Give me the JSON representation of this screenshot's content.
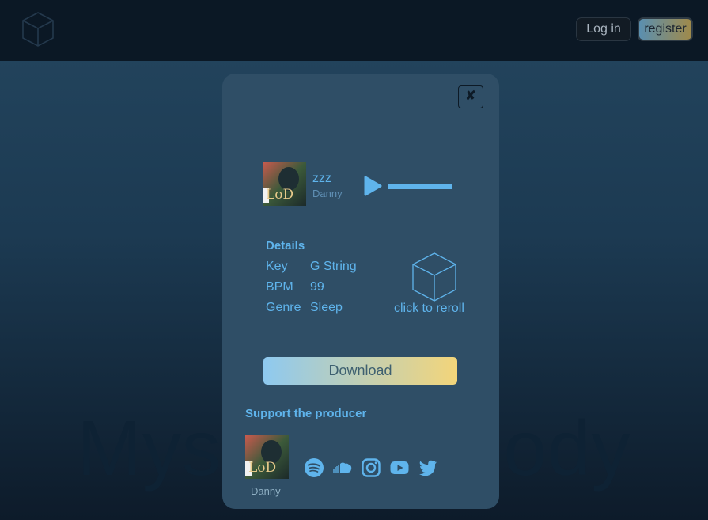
{
  "header": {
    "login_label": "Log in",
    "register_label": "register"
  },
  "background": {
    "title": "Mystery Melody"
  },
  "modal": {
    "close_label": "✘",
    "track": {
      "title": "zzz",
      "artist": "Danny"
    },
    "details": {
      "heading": "Details",
      "rows": [
        {
          "label": "Key",
          "value": "G String"
        },
        {
          "label": "BPM",
          "value": "99"
        },
        {
          "label": "Genre",
          "value": "Sleep"
        }
      ]
    },
    "reroll_label": "click to reroll",
    "download_label": "Download",
    "support": {
      "heading": "Support the producer",
      "producer_name": "Danny",
      "socials": [
        "spotify-icon",
        "soundcloud-icon",
        "instagram-icon",
        "youtube-icon",
        "twitter-icon"
      ]
    }
  },
  "colors": {
    "accent": "#5fb4ec",
    "modal_bg": "#2f4e66",
    "topbar_bg": "#0b1825"
  }
}
